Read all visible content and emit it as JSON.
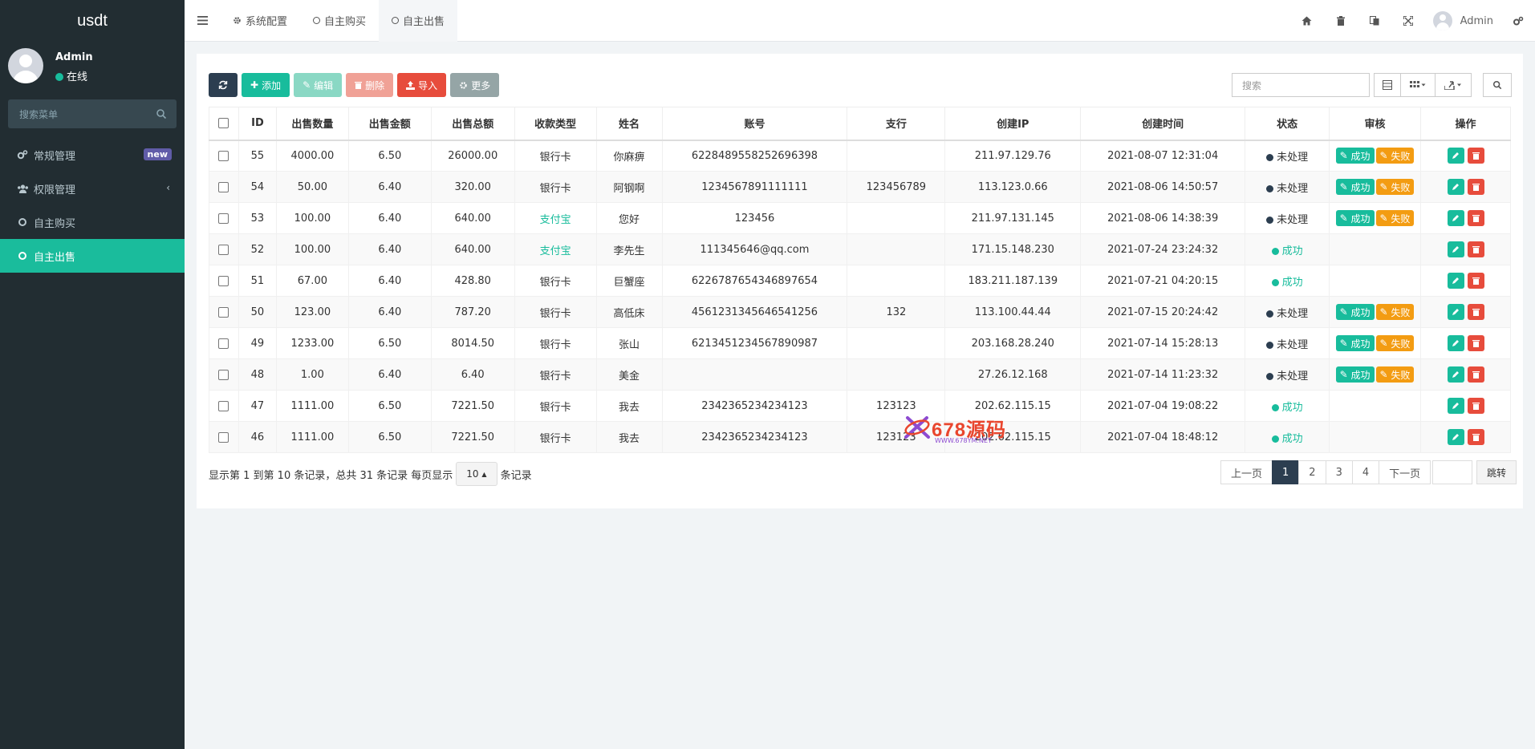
{
  "app": {
    "logo": "usdt",
    "accent": "#18bc9c",
    "sidebar_bg": "#222d32"
  },
  "user": {
    "name": "Admin",
    "status": "在线",
    "status_color": "#18bc9c"
  },
  "sidebar": {
    "search_placeholder": "搜索菜单",
    "items": [
      {
        "label": "常规管理",
        "icon": "cogs-icon",
        "badge": "new"
      },
      {
        "label": "权限管理",
        "icon": "group-icon"
      },
      {
        "label": "自主购买",
        "icon": "circle-icon"
      },
      {
        "label": "自主出售",
        "icon": "circle-icon",
        "active": true
      }
    ]
  },
  "topbar": {
    "tabs": [
      {
        "label": "系统配置",
        "icon": "gear-icon"
      },
      {
        "label": "自主购买",
        "icon": "circle-icon"
      },
      {
        "label": "自主出售",
        "icon": "circle-icon",
        "active": true
      }
    ],
    "user": "Admin"
  },
  "toolbar": {
    "add": "添加",
    "edit": "编辑",
    "delete": "删除",
    "import": "导入",
    "more": "更多",
    "search_placeholder": "搜索"
  },
  "table": {
    "columns": [
      "ID",
      "出售数量",
      "出售金额",
      "出售总额",
      "收款类型",
      "姓名",
      "账号",
      "支行",
      "创建IP",
      "创建时间",
      "状态",
      "审核",
      "操作"
    ],
    "rows": [
      {
        "id": "55",
        "qty": "4000.00",
        "price": "6.50",
        "total": "26000.00",
        "type": "银行卡",
        "name": "你麻痹",
        "account": "6228489558252696398",
        "branch": "",
        "ip": "211.97.129.76",
        "time": "2021-08-07 12:31:04",
        "status": "未处理"
      },
      {
        "id": "54",
        "qty": "50.00",
        "price": "6.40",
        "total": "320.00",
        "type": "银行卡",
        "name": "阿钢啊",
        "account": "1234567891111111",
        "branch": "123456789",
        "ip": "113.123.0.66",
        "time": "2021-08-06 14:50:57",
        "status": "未处理"
      },
      {
        "id": "53",
        "qty": "100.00",
        "price": "6.40",
        "total": "640.00",
        "type": "支付宝",
        "name": "您好",
        "account": "123456",
        "branch": "",
        "ip": "211.97.131.145",
        "time": "2021-08-06 14:38:39",
        "status": "未处理"
      },
      {
        "id": "52",
        "qty": "100.00",
        "price": "6.40",
        "total": "640.00",
        "type": "支付宝",
        "name": "李先生",
        "account": "111345646@qq.com",
        "branch": "",
        "ip": "171.15.148.230",
        "time": "2021-07-24 23:24:32",
        "status": "成功"
      },
      {
        "id": "51",
        "qty": "67.00",
        "price": "6.40",
        "total": "428.80",
        "type": "银行卡",
        "name": "巨蟹座",
        "account": "6226787654346897654",
        "branch": "",
        "ip": "183.211.187.139",
        "time": "2021-07-21 04:20:15",
        "status": "成功"
      },
      {
        "id": "50",
        "qty": "123.00",
        "price": "6.40",
        "total": "787.20",
        "type": "银行卡",
        "name": "高低床",
        "account": "4561231345646541256",
        "branch": "132",
        "ip": "113.100.44.44",
        "time": "2021-07-15 20:24:42",
        "status": "未处理"
      },
      {
        "id": "49",
        "qty": "1233.00",
        "price": "6.50",
        "total": "8014.50",
        "type": "银行卡",
        "name": "张山",
        "account": "6213451234567890987",
        "branch": "",
        "ip": "203.168.28.240",
        "time": "2021-07-14 15:28:13",
        "status": "未处理"
      },
      {
        "id": "48",
        "qty": "1.00",
        "price": "6.40",
        "total": "6.40",
        "type": "银行卡",
        "name": "美金",
        "account": "",
        "branch": "",
        "ip": "27.26.12.168",
        "time": "2021-07-14 11:23:32",
        "status": "未处理"
      },
      {
        "id": "47",
        "qty": "1111.00",
        "price": "6.50",
        "total": "7221.50",
        "type": "银行卡",
        "name": "我去",
        "account": "2342365234234123",
        "branch": "123123",
        "ip": "202.62.115.15",
        "time": "2021-07-04 19:08:22",
        "status": "成功"
      },
      {
        "id": "46",
        "qty": "1111.00",
        "price": "6.50",
        "total": "7221.50",
        "type": "银行卡",
        "name": "我去",
        "account": "2342365234234123",
        "branch": "123123",
        "ip": "202.62.115.15",
        "time": "2021-07-04 18:48:12",
        "status": "成功"
      }
    ],
    "approve_label": "成功",
    "reject_label": "失败",
    "pending_color": "#2c3e50",
    "done_color": "#18bc9c"
  },
  "footer": {
    "summary": "显示第 1 到第 10 条记录，总共 31 条记录 每页显示",
    "page_size": "10",
    "suffix": "条记录",
    "prev": "上一页",
    "pages": [
      "1",
      "2",
      "3",
      "4"
    ],
    "next": "下一页",
    "jump": "跳转"
  },
  "watermark": {
    "text": "678源码",
    "sub": "WWW.678YM.NET"
  }
}
